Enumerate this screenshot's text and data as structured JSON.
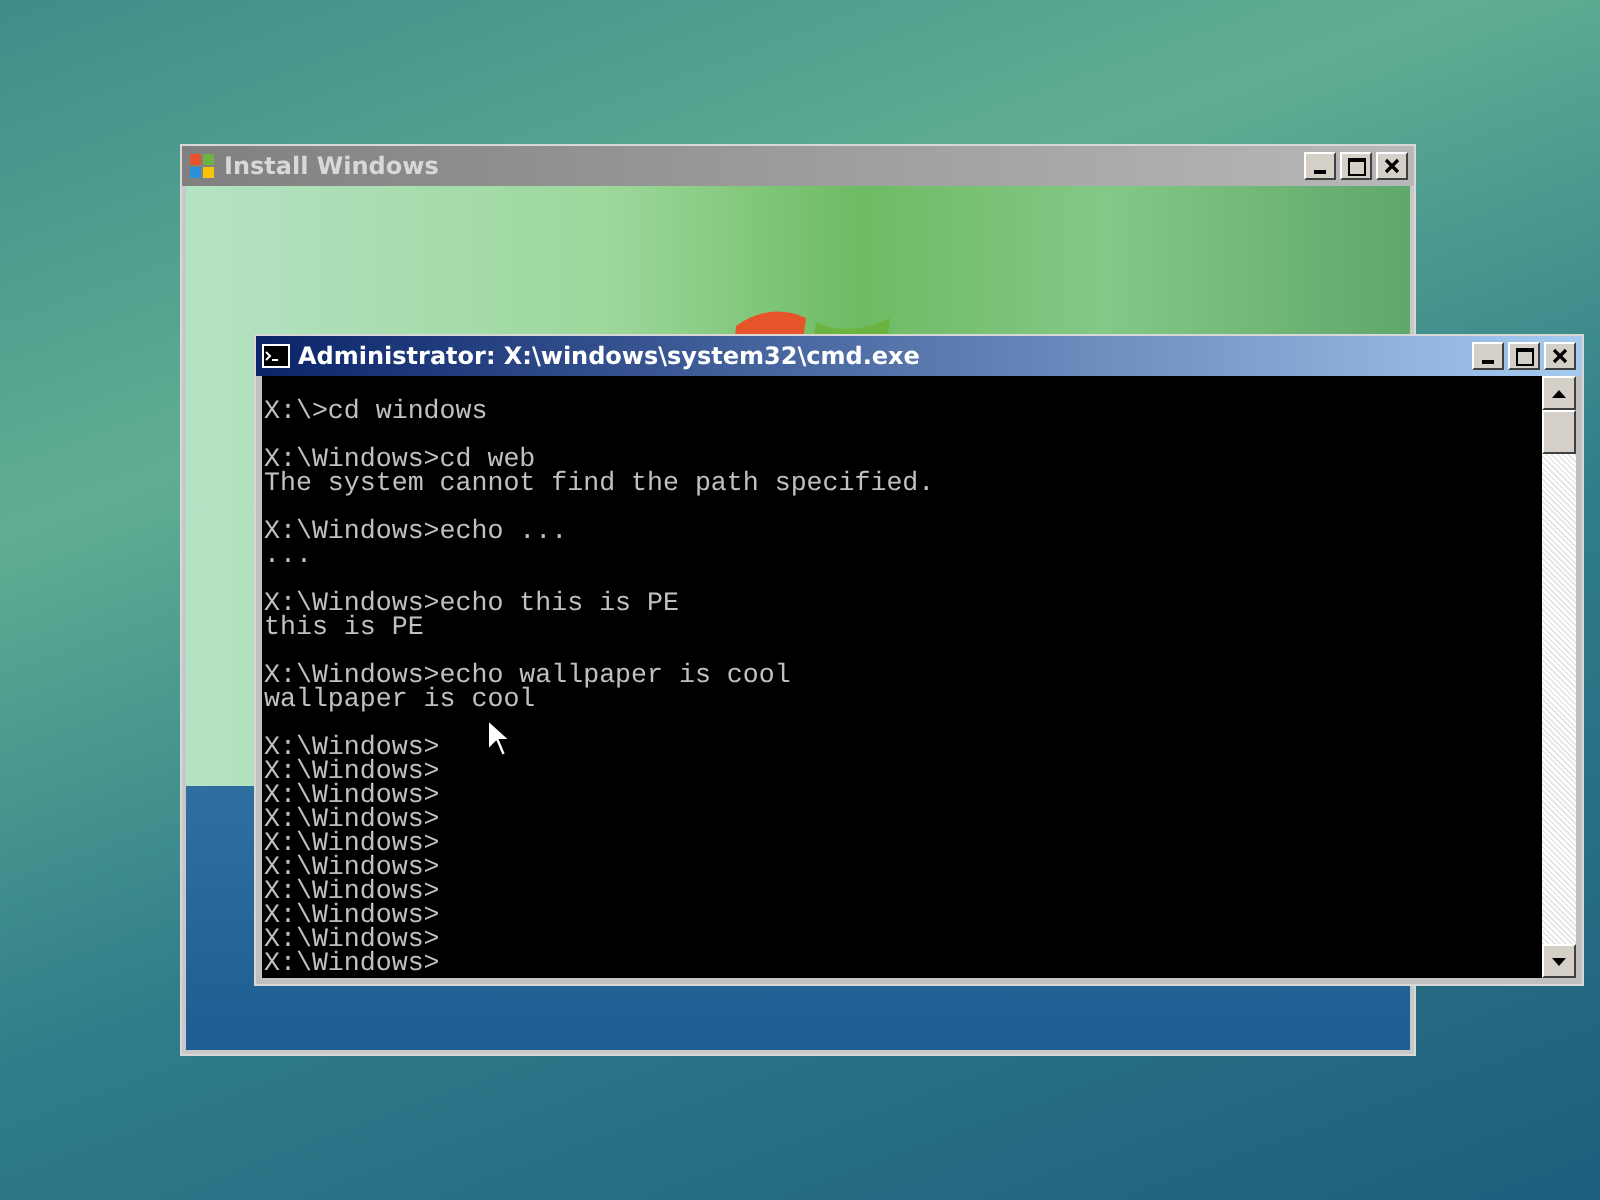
{
  "setup_window": {
    "title": "Install Windows"
  },
  "console_window": {
    "title": "Administrator: X:\\windows\\system32\\cmd.exe",
    "blocks": [
      [
        "X:\\>cd windows"
      ],
      [
        "X:\\Windows>cd web",
        "The system cannot find the path specified."
      ],
      [
        "X:\\Windows>echo ...",
        "..."
      ],
      [
        "X:\\Windows>echo this is PE",
        "this is PE"
      ],
      [
        "X:\\Windows>echo wallpaper is cool",
        "wallpaper is cool"
      ],
      [
        "X:\\Windows>",
        "X:\\Windows>",
        "X:\\Windows>",
        "X:\\Windows>",
        "X:\\Windows>",
        "X:\\Windows>",
        "X:\\Windows>",
        "X:\\Windows>",
        "X:\\Windows>",
        "X:\\Windows>"
      ]
    ]
  }
}
